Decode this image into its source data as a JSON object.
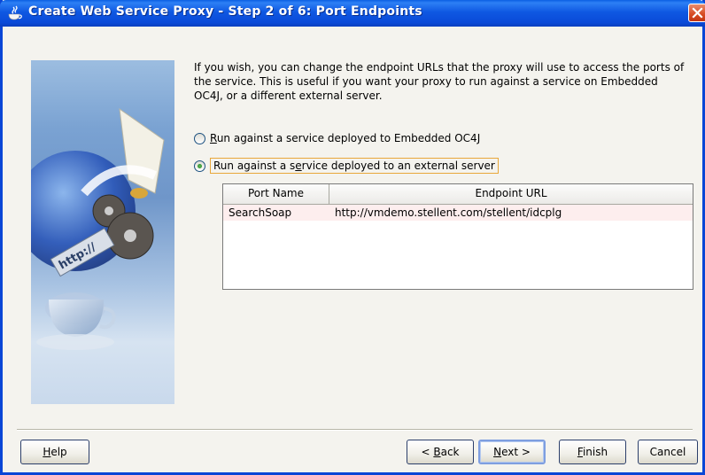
{
  "window": {
    "title": "Create Web Service Proxy - Step 2 of 6: Port Endpoints"
  },
  "intro_text": "If you wish, you can change the endpoint URLs that the proxy will use to access the ports of the service. This is useful if you want your proxy to run against a service on Embedded OC4J, or a different external server.",
  "options": [
    {
      "mnemonic": "R",
      "label_rest": "un against a service deployed to Embedded OC4J",
      "selected": false
    },
    {
      "label_pre": "Run against a s",
      "mnemonic": "e",
      "label_rest": "rvice deployed to an external server",
      "selected": true
    }
  ],
  "table": {
    "columns": [
      "Port Name",
      "Endpoint URL"
    ],
    "rows": [
      {
        "port_name": "SearchSoap",
        "endpoint_url": "http://vmdemo.stellent.com/stellent/idcplg"
      }
    ]
  },
  "buttons": {
    "help": {
      "mnemonic": "H",
      "rest": "elp"
    },
    "back": {
      "pre": "< ",
      "mnemonic": "B",
      "rest": "ack"
    },
    "next": {
      "mnemonic": "N",
      "rest": "ext >"
    },
    "finish": {
      "mnemonic": "F",
      "rest": "inish"
    },
    "cancel": "Cancel"
  },
  "icons": {
    "title_icon": "coffee-cup-icon",
    "close": "close-icon"
  },
  "colors": {
    "title_bar": "#0a4ad8",
    "selected_row": "#fdeeee",
    "focus_outline": "#e8a73a"
  }
}
